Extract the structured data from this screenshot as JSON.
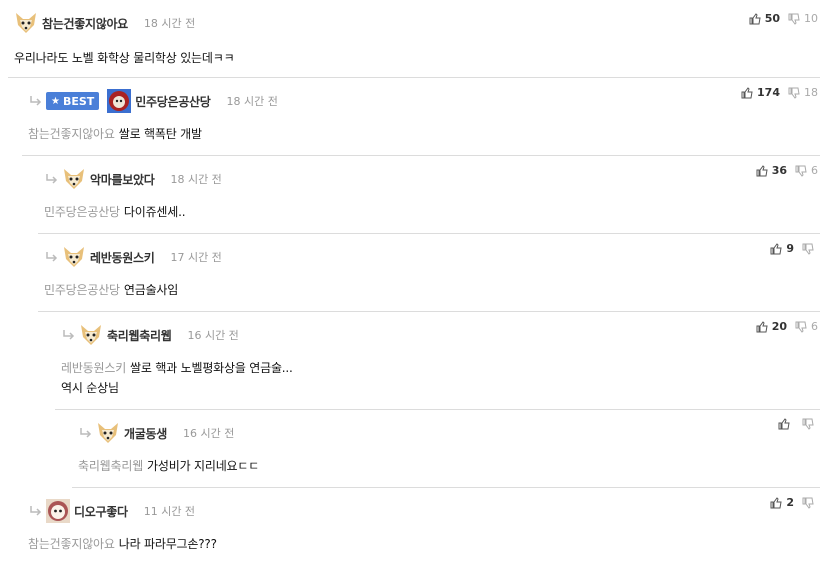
{
  "comments": [
    {
      "nick": "참는건좋지않아요",
      "time": "18 시간 전",
      "mention": "",
      "text": "우리나라도 노벨 화학상 물리학상 있는데ㅋㅋ",
      "text2": "",
      "up": "50",
      "down": "10",
      "best": false
    },
    {
      "nick": "민주당은공산당",
      "time": "18 시간 전",
      "mention": "참는건좋지않아요",
      "text": "쌀로 핵폭탄 개발",
      "text2": "",
      "up": "174",
      "down": "18",
      "best": true,
      "best_label": "BEST"
    },
    {
      "nick": "악마를보았다",
      "time": "18 시간 전",
      "mention": "민주당은공산당",
      "text": "다이쥬센세..",
      "text2": "",
      "up": "36",
      "down": "6",
      "best": false
    },
    {
      "nick": "레반동원스키",
      "time": "17 시간 전",
      "mention": "민주당은공산당",
      "text": "연금술사임",
      "text2": "",
      "up": "9",
      "down": "",
      "best": false
    },
    {
      "nick": "축리웹축리웹",
      "time": "16 시간 전",
      "mention": "레반동원스키",
      "text": "쌀로 핵과 노벨평화상을 연금술...",
      "text2": "역시 순상님",
      "up": "20",
      "down": "6",
      "best": false
    },
    {
      "nick": "개굴동생",
      "time": "16 시간 전",
      "mention": "축리웹축리웹",
      "text": "가성비가 지리네요ㄷㄷ",
      "text2": "",
      "up": "",
      "down": "",
      "best": false
    },
    {
      "nick": "디오구좋다",
      "time": "11 시간 전",
      "mention": "참는건좋지않아요",
      "text": "나라 파라무그손???",
      "text2": "",
      "up": "2",
      "down": "",
      "best": false
    }
  ],
  "colors": {
    "accent": "#4a7fd8",
    "divider": "#dcdcdc",
    "muted": "#999999"
  }
}
